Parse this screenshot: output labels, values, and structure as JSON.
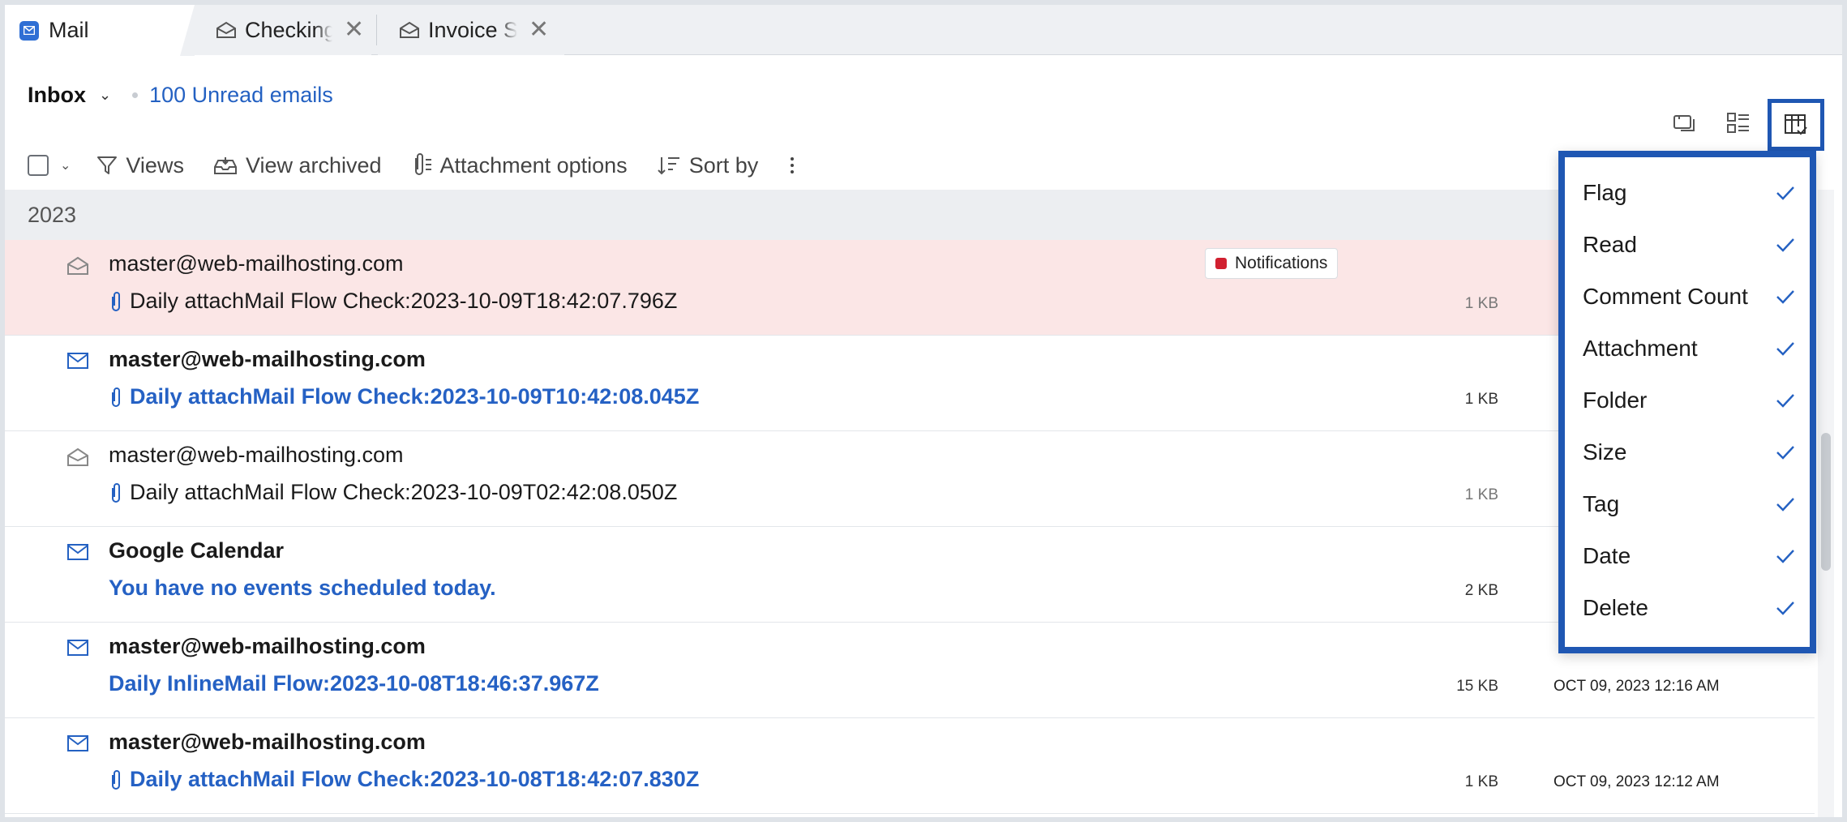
{
  "tabs": [
    {
      "label": "Mail",
      "icon": "mail-app-icon"
    },
    {
      "label": "Checking p",
      "icon": "envelope-open-icon"
    },
    {
      "label": "Invoice Su",
      "icon": "envelope-open-icon"
    }
  ],
  "header": {
    "folder": "Inbox",
    "unread": "100 Unread emails"
  },
  "toolbar": {
    "views": "Views",
    "view_archived": "View archived",
    "attachment_options": "Attachment options",
    "sort_by": "Sort by"
  },
  "year_group": "2023",
  "emails": [
    {
      "sender": "master@web-mailhosting.com",
      "subject": "Daily attachMail Flow Check:2023-10-09T18:42:07.796Z",
      "size": "1 KB",
      "date": "",
      "unread": false,
      "attachment": true,
      "tag": "Notifications"
    },
    {
      "sender": "master@web-mailhosting.com",
      "subject": "Daily attachMail Flow Check:2023-10-09T10:42:08.045Z",
      "size": "1 KB",
      "date": "",
      "unread": true,
      "attachment": true,
      "tag": ""
    },
    {
      "sender": "master@web-mailhosting.com",
      "subject": "Daily attachMail Flow Check:2023-10-09T02:42:08.050Z",
      "size": "1 KB",
      "date": "",
      "unread": false,
      "attachment": true,
      "tag": ""
    },
    {
      "sender": "Google Calendar",
      "subject": "You have no events scheduled today.",
      "size": "2 KB",
      "date": "",
      "unread": true,
      "attachment": false,
      "tag": ""
    },
    {
      "sender": "master@web-mailhosting.com",
      "subject": "Daily InlineMail Flow:2023-10-08T18:46:37.967Z",
      "size": "15 KB",
      "date": "OCT 09, 2023 12:16 AM",
      "unread": true,
      "attachment": false,
      "tag": ""
    },
    {
      "sender": "master@web-mailhosting.com",
      "subject": "Daily attachMail Flow Check:2023-10-08T18:42:07.830Z",
      "size": "1 KB",
      "date": "OCT 09, 2023 12:12 AM",
      "unread": true,
      "attachment": true,
      "tag": ""
    }
  ],
  "column_menu": {
    "items": [
      {
        "label": "Flag",
        "checked": true
      },
      {
        "label": "Read",
        "checked": true
      },
      {
        "label": "Comment Count",
        "checked": true
      },
      {
        "label": "Attachment",
        "checked": true
      },
      {
        "label": "Folder",
        "checked": true
      },
      {
        "label": "Size",
        "checked": true
      },
      {
        "label": "Tag",
        "checked": true
      },
      {
        "label": "Date",
        "checked": true
      },
      {
        "label": "Delete",
        "checked": true
      }
    ]
  },
  "colors": {
    "accent": "#2461c2",
    "highlight_row": "#fbe6e6",
    "tag_red": "#d12030",
    "menu_border": "#1f57b3"
  }
}
